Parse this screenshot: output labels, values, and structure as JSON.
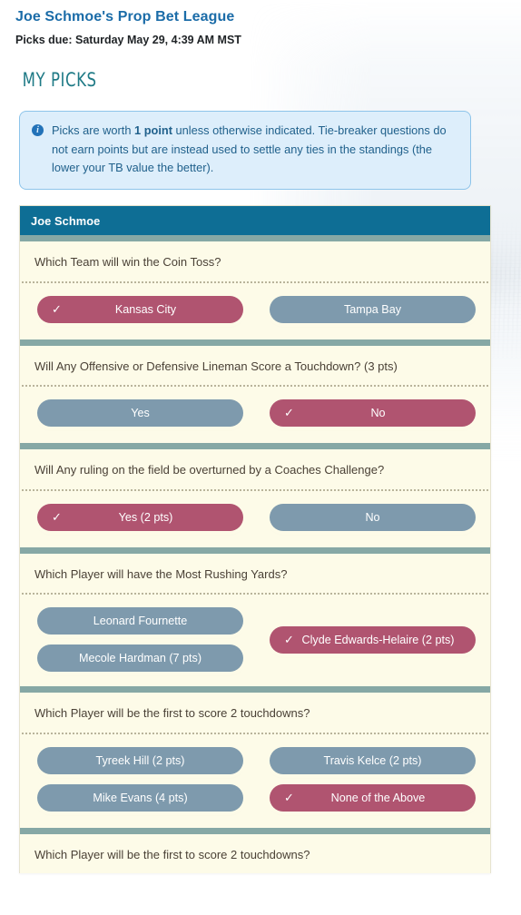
{
  "header": {
    "league_title": "Joe Schmoe's Prop Bet League",
    "due_label": "Picks due:",
    "due_value": "Saturday May 29, 4:39 AM MST",
    "section_title": "MY PICKS"
  },
  "alert": {
    "icon": "info-icon",
    "text_part1": "Picks are worth ",
    "text_bold": "1 point",
    "text_part2": " unless otherwise indicated. Tie-breaker questions do not earn points but are instead used to settle any ties in the standings (the lower your TB value the better)."
  },
  "card": {
    "owner": "Joe Schmoe"
  },
  "colors": {
    "title_blue": "#1b6ca8",
    "section_teal": "#1f7a86",
    "card_header": "#0e6e95",
    "divider_sage": "#86a8a5",
    "card_bg": "#fdfbe8",
    "option_unselected": "#7e9aad",
    "option_selected": "#b05470",
    "alert_bg": "#ddeefb",
    "alert_border": "#8dc4ea",
    "alert_text": "#21618c"
  },
  "questions": [
    {
      "text": "Which Team will win the Coin Toss?",
      "layout": "grid",
      "options": [
        {
          "label": "Kansas City",
          "selected": true,
          "check": "✓"
        },
        {
          "label": "Tampa Bay",
          "selected": false,
          "check": ""
        }
      ]
    },
    {
      "text": "Will Any Offensive or Defensive Lineman Score a Touchdown? (3 pts)",
      "layout": "grid",
      "options": [
        {
          "label": "Yes",
          "selected": false,
          "check": ""
        },
        {
          "label": "No",
          "selected": true,
          "check": "✓"
        }
      ]
    },
    {
      "text": "Will Any ruling on the field be overturned by a Coaches Challenge?",
      "layout": "grid",
      "options": [
        {
          "label": "Yes (2 pts)",
          "selected": true,
          "check": "✓"
        },
        {
          "label": "No",
          "selected": false,
          "check": ""
        }
      ]
    },
    {
      "text": "Which Player will have the Most Rushing Yards?",
      "layout": "stagger",
      "options": [
        {
          "label": "Leonard Fournette",
          "selected": false,
          "check": ""
        },
        {
          "label": "Clyde Edwards-Helaire (2 pts)",
          "selected": true,
          "check": "✓"
        },
        {
          "label": "Mecole Hardman (7 pts)",
          "selected": false,
          "check": ""
        }
      ]
    },
    {
      "text": "Which Player will be the first to score 2 touchdowns?",
      "layout": "grid",
      "options": [
        {
          "label": "Tyreek Hill (2 pts)",
          "selected": false,
          "check": ""
        },
        {
          "label": "Travis Kelce (2 pts)",
          "selected": false,
          "check": ""
        },
        {
          "label": "Mike Evans (4 pts)",
          "selected": false,
          "check": ""
        },
        {
          "label": "None of the Above",
          "selected": true,
          "check": "✓"
        }
      ]
    },
    {
      "text": "Which Player will be the first to score 2 touchdowns?",
      "layout": "grid",
      "options": []
    }
  ]
}
